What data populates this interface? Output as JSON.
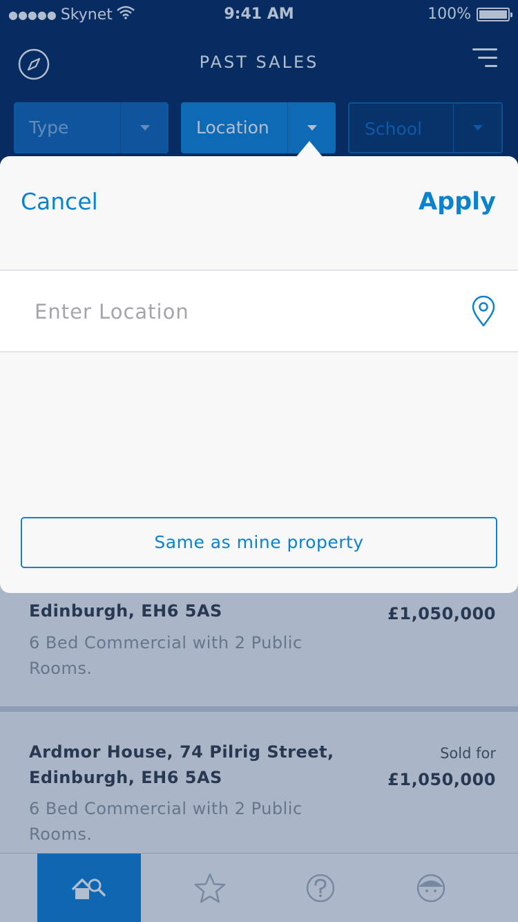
{
  "status_bar": {
    "signal": "●●●●●",
    "carrier": "Skynet",
    "time": "9:41 AM",
    "battery": "100%"
  },
  "nav": {
    "title": "PAST SALES",
    "left_icon": "compass-icon",
    "right_icon": "filter-icon"
  },
  "filters": [
    {
      "label": "Type",
      "state": "inactive"
    },
    {
      "label": "Location",
      "state": "active"
    },
    {
      "label": "School",
      "state": "outlined"
    }
  ],
  "popover": {
    "cancel_label": "Cancel",
    "apply_label": "Apply",
    "location_placeholder": "Enter Location",
    "location_value": "",
    "location_icon": "map-pin-icon",
    "same_button_label": "Same as mine property"
  },
  "listings": [
    {
      "address": "Edinburgh, EH6 5AS",
      "description": "6 Bed Commercial with 2 Public Rooms.",
      "price": "£1,050,000"
    },
    {
      "address": "Ardmor House, 74 Pilrig Street, Edinburgh, EH6 5AS",
      "description": "6 Bed Commercial with 2 Public Rooms.",
      "sold_label": "Sold for",
      "price": "£1,050,000"
    }
  ],
  "tabbar": [
    {
      "icon": "home-search-icon",
      "active": true
    },
    {
      "icon": "star-icon",
      "active": false
    },
    {
      "icon": "help-icon",
      "active": false
    },
    {
      "icon": "profile-icon",
      "active": false
    }
  ],
  "colors": {
    "header": "#00285e",
    "accent": "#0b82cf",
    "active_filter": "#0b84d8"
  }
}
